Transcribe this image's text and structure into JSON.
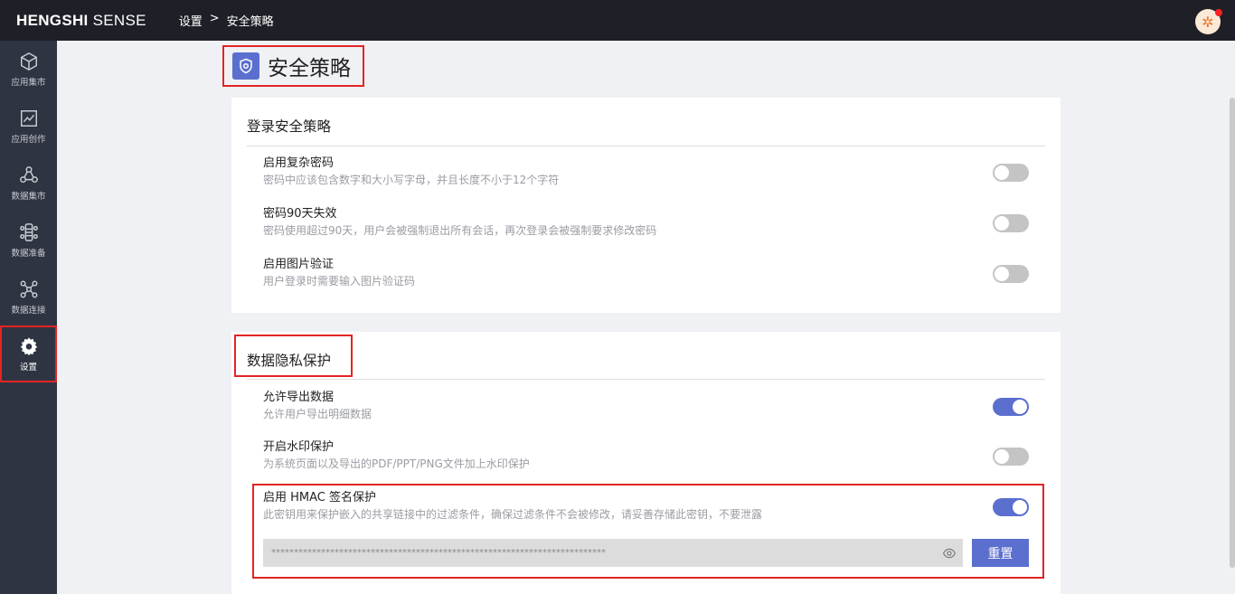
{
  "header": {
    "logo_bold": "HENGSHI",
    "logo_light": " SENSE",
    "breadcrumb": [
      "设置",
      ">",
      "安全策略"
    ],
    "avatar_icon": "user-avatar-icon"
  },
  "sidebar": {
    "items": [
      {
        "label": "应用集市",
        "icon": "cube-icon"
      },
      {
        "label": "应用创作",
        "icon": "chart-line-icon"
      },
      {
        "label": "数据集市",
        "icon": "dataset-nodes-icon"
      },
      {
        "label": "数据准备",
        "icon": "data-prep-icon"
      },
      {
        "label": "数据连接",
        "icon": "network-icon"
      },
      {
        "label": "设置",
        "icon": "gear-icon",
        "active": true
      }
    ]
  },
  "page": {
    "title": "安全策略",
    "title_icon": "shield-icon"
  },
  "login_policy": {
    "title": "登录安全策略",
    "items": [
      {
        "label": "启用复杂密码",
        "desc": "密码中应该包含数字和大小写字母，并且长度不小于12个字符",
        "enabled": false
      },
      {
        "label": "密码90天失效",
        "desc": "密码使用超过90天，用户会被强制退出所有会话，再次登录会被强制要求修改密码",
        "enabled": false
      },
      {
        "label": "启用图片验证",
        "desc": "用户登录时需要输入图片验证码",
        "enabled": false
      }
    ]
  },
  "privacy": {
    "title": "数据隐私保护",
    "items": [
      {
        "label": "允许导出数据",
        "desc": "允许用户导出明细数据",
        "enabled": true
      },
      {
        "label": "开启水印保护",
        "desc": "为系统页面以及导出的PDF/PPT/PNG文件加上水印保护",
        "enabled": false
      },
      {
        "label": "启用 HMAC 签名保护",
        "desc": "此密钥用来保护嵌入的共享链接中的过滤条件，确保过滤条件不会被修改，请妥善存储此密钥，不要泄露",
        "enabled": true
      }
    ],
    "secret_value": "**************************************************************************",
    "reset_label": "重置"
  },
  "colors": {
    "accent": "#5b6fcf",
    "highlight": "#e32424",
    "sidebar": "#2f3442",
    "topbar": "#1f2027"
  }
}
